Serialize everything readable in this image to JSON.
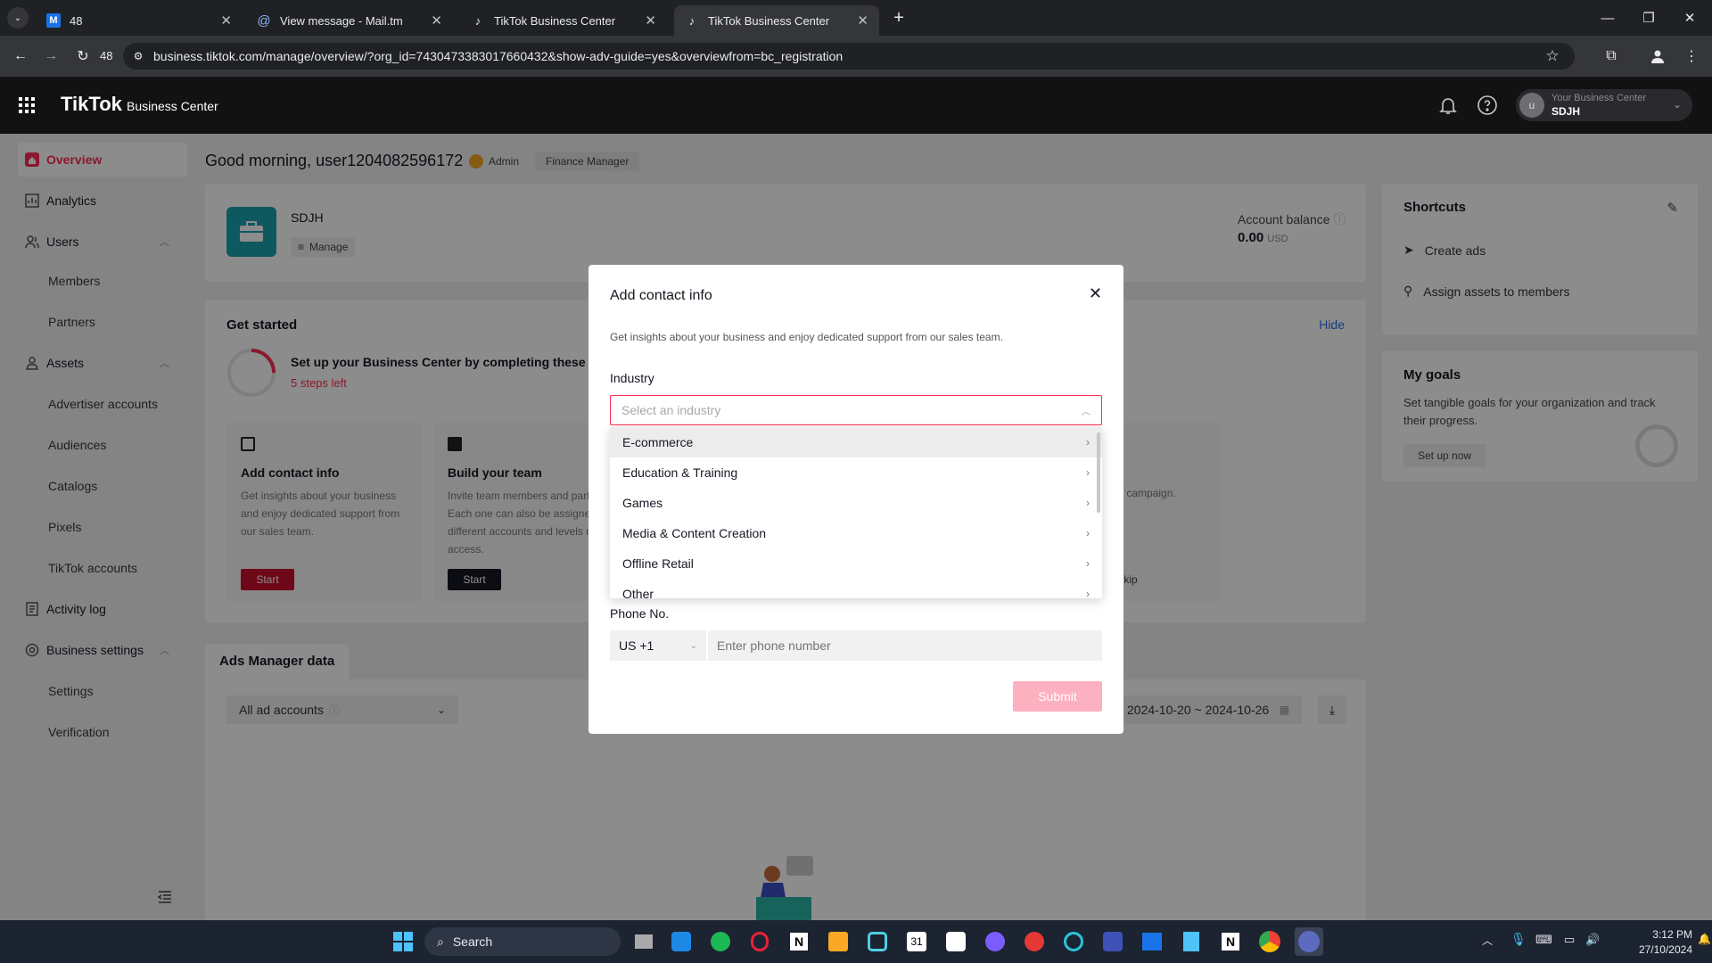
{
  "browser": {
    "tabs": [
      {
        "title": "48",
        "icon": "mail-icon"
      },
      {
        "title": "View message - Mail.tm",
        "icon": "at-icon"
      },
      {
        "title": "TikTok Business Center",
        "icon": "tiktok-icon"
      },
      {
        "title": "TikTok Business Center",
        "icon": "tiktok-icon"
      }
    ],
    "url": "business.tiktok.com/manage/overview/?org_id=7430473383017660432&show-adv-guide=yes&overviewfrom=bc_registration",
    "reload_badge": "48"
  },
  "app": {
    "logo": "TikTok",
    "product": "Business Center",
    "account_caption": "Your Business Center",
    "account_name": "SDJH",
    "avatar_letter": "u"
  },
  "sidebar": {
    "overview": "Overview",
    "analytics": "Analytics",
    "users": "Users",
    "members": "Members",
    "partners": "Partners",
    "assets": "Assets",
    "advertiser_accounts": "Advertiser accounts",
    "audiences": "Audiences",
    "catalogs": "Catalogs",
    "pixels": "Pixels",
    "tiktok_accounts": "TikTok accounts",
    "activity_log": "Activity log",
    "business_settings": "Business settings",
    "settings": "Settings",
    "verification": "Verification"
  },
  "main": {
    "greeting": "Good morning, user1204082596172",
    "role_admin": "Admin",
    "role_finance": "Finance Manager",
    "bc_name": "SDJH",
    "manage": "Manage",
    "balance_label": "Account balance",
    "balance_value": "0.00",
    "balance_currency": "USD",
    "get_started": "Get started",
    "hide": "Hide",
    "setup_text": "Set up your Business Center by completing these tas",
    "steps_left": "5 steps left",
    "task1_title": "Add contact info",
    "task1_desc": "Get insights about your business and enjoy dedicated support from our sales team.",
    "task1_btn": "Start",
    "task2_title": "Build your team",
    "task2_desc": "Invite team members and part. Each one can also be assigned different accounts and levels of access.",
    "task2_btn": "Start",
    "task4_title_frag": "s",
    "task4_desc_frag": "first ad campaign.",
    "skip": "Skip",
    "ads_manager": "Ads Manager data",
    "all_ad_accounts": "All ad accounts",
    "date_range": "2024-10-20 ~ 2024-10-26"
  },
  "shortcuts": {
    "title": "Shortcuts",
    "create_ads": "Create ads",
    "assign_assets": "Assign assets to members"
  },
  "goals": {
    "title": "My goals",
    "desc": "Set tangible goals for your organization and track their progress.",
    "btn": "Set up now"
  },
  "modal": {
    "title": "Add contact info",
    "subtitle": "Get insights about your business and enjoy dedicated support from our sales team.",
    "industry_label": "Industry",
    "industry_placeholder": "Select an industry",
    "options": [
      "E-commerce",
      "Education & Training",
      "Games",
      "Media & Content Creation",
      "Offline Retail",
      "Other"
    ],
    "phone_label": "Phone No.",
    "country_code": "US +1",
    "phone_placeholder": "Enter phone number",
    "submit": "Submit"
  },
  "taskbar": {
    "search": "Search",
    "time": "3:12 PM",
    "date": "27/10/2024"
  },
  "colors": {
    "brand": "#fe2c55",
    "danger_red": "#c8102e"
  }
}
